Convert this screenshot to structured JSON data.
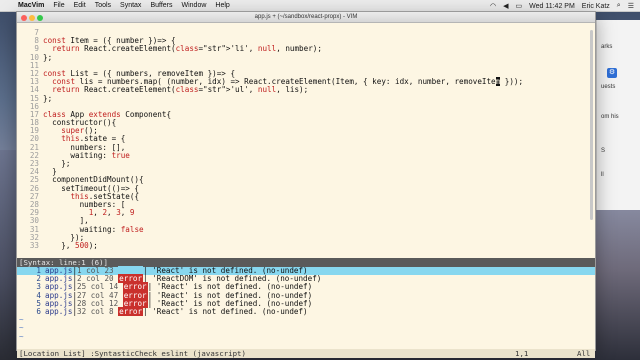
{
  "menubar": {
    "apple_icon": "apple-icon",
    "app_name": "MacVim",
    "menus": [
      "File",
      "Edit",
      "Tools",
      "Syntax",
      "Buffers",
      "Window",
      "Help"
    ],
    "clock": "Wed 11:42 PM",
    "user": "Eric Katz"
  },
  "window": {
    "title": "app.js + (~/sandbox/react-propx) - VIM"
  },
  "background_window": {
    "lines": [
      "arks",
      "uests",
      "om his",
      "S",
      "ll"
    ]
  },
  "code_lines": [
    {
      "n": "7",
      "text": ""
    },
    {
      "n": "8",
      "text": "const Item = ({ number })=> {"
    },
    {
      "n": "9",
      "text": "  return React.createElement('li', null, number);"
    },
    {
      "n": "10",
      "text": "};"
    },
    {
      "n": "11",
      "text": ""
    },
    {
      "n": "12",
      "text": "const List = ({ numbers, removeItem })=> {"
    },
    {
      "n": "13",
      "text": "  const lis = numbers.map( (number, idx) => React.createElement(Item, { key: idx, number, removeIte"
    },
    {
      "n": "14",
      "text": "  return React.createElement('ul', null, lis);"
    },
    {
      "n": "15",
      "text": "};"
    },
    {
      "n": "16",
      "text": ""
    },
    {
      "n": "17",
      "text": "class App extends Component{"
    },
    {
      "n": "18",
      "text": "  constructor(){"
    },
    {
      "n": "19",
      "text": "    super();"
    },
    {
      "n": "20",
      "text": "    this.state = {"
    },
    {
      "n": "21",
      "text": "      numbers: [],"
    },
    {
      "n": "22",
      "text": "      waiting: true"
    },
    {
      "n": "23",
      "text": "    };"
    },
    {
      "n": "24",
      "text": "  }"
    },
    {
      "n": "25",
      "text": "  componentDidMount(){"
    },
    {
      "n": "26",
      "text": "    setTimeout(()=> {"
    },
    {
      "n": "27",
      "text": "      this.setState({"
    },
    {
      "n": "28",
      "text": "        numbers: ["
    },
    {
      "n": "29",
      "text": "          1, 2, 3, 9"
    },
    {
      "n": "30",
      "text": "        ],"
    },
    {
      "n": "31",
      "text": "        waiting: false"
    },
    {
      "n": "32",
      "text": "      });"
    },
    {
      "n": "33",
      "text": "    }, 500);"
    }
  ],
  "cursor": {
    "char": "m",
    "rest": " }));"
  },
  "statusline": "[Syntax: line:1 (6)]",
  "location_list": [
    {
      "idx": "1",
      "file": "app.js",
      "pos": "1 col 23",
      "type": "error",
      "msg": "'React' is not defined. (no-undef)"
    },
    {
      "idx": "2",
      "file": "app.js",
      "pos": "2 col 20",
      "type": "error",
      "msg": "'ReactDOM' is not defined. (no-undef)"
    },
    {
      "idx": "3",
      "file": "app.js",
      "pos": "25 col 14",
      "type": "error",
      "msg": "'React' is not defined. (no-undef)"
    },
    {
      "idx": "4",
      "file": "app.js",
      "pos": "27 col 47",
      "type": "error",
      "msg": "'React' is not defined. (no-undef)"
    },
    {
      "idx": "5",
      "file": "app.js",
      "pos": "28 col 12",
      "type": "error",
      "msg": "'React' is not defined. (no-undef)"
    },
    {
      "idx": "6",
      "file": "app.js",
      "pos": "32 col 8",
      "type": "error",
      "msg": "'React' is not defined. (no-undef)"
    }
  ],
  "tildes": [
    "~",
    "~",
    "~"
  ],
  "cmdline": {
    "text": "[Location List] :SyntasticCheck eslint (javascript)",
    "position": "1,1",
    "percent": "All"
  }
}
